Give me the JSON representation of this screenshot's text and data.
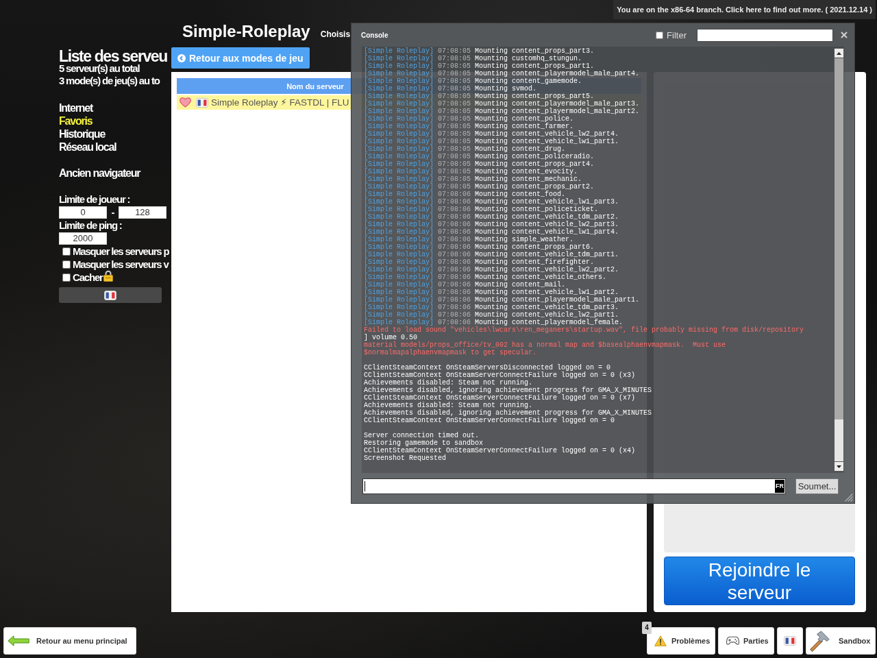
{
  "banner": {
    "text": "You are on the x86-64 branch. Click here to find out more. ( 2021.12.14 )"
  },
  "header": {
    "title": "Simple-Roleplay",
    "subtitle": "Choisis",
    "back_button": "Retour aux modes de jeu"
  },
  "sidebar": {
    "title": "Liste des serveu",
    "stats": [
      "5 serveur(s) au total",
      "3 mode(s) de jeu(s) au to"
    ],
    "tabs": [
      {
        "label": "Internet",
        "selected": false
      },
      {
        "label": "Favoris",
        "selected": true
      },
      {
        "label": "Historique",
        "selected": false
      },
      {
        "label": "Réseau local",
        "selected": false
      }
    ],
    "legacy_link": "Ancien navigateur",
    "player_limit": {
      "label": "Limite de joueur :",
      "min": "0",
      "separator": "-",
      "max": "128"
    },
    "ping_limit": {
      "label": "Limite de ping :",
      "value": "2000"
    },
    "options": [
      {
        "label": "Masquer les serveurs p",
        "checked": false
      },
      {
        "label": "Masquer les serveurs v",
        "checked": false
      },
      {
        "label": "Cacher",
        "checked": false,
        "locked": true
      }
    ]
  },
  "server_table": {
    "columns": [
      "Nom du serveur"
    ],
    "rows": [
      {
        "favorite": true,
        "name": "Simple Roleplay ⚡ FASTDL | FLU",
        "selected": true
      }
    ]
  },
  "server_details": {
    "join_button": "Rejoindre le serveur"
  },
  "console": {
    "title": "Console",
    "filter": {
      "label": "Filter",
      "checked": false
    },
    "lines": [
      {
        "kind": "server",
        "source": "[Simple Roleplay]",
        "time": "07:08:05",
        "text": "Mounting content_props_part3."
      },
      {
        "kind": "server",
        "source": "[Simple Roleplay]",
        "time": "07:08:05",
        "text": "Mounting customhq_stungun."
      },
      {
        "kind": "server",
        "source": "[Simple Roleplay]",
        "time": "07:08:05",
        "text": "Mounting content_props_part1."
      },
      {
        "kind": "server",
        "source": "[Simple Roleplay]",
        "time": "07:08:05",
        "text": "Mounting content_playermodel_male_part4."
      },
      {
        "kind": "server",
        "source": "[Simple Roleplay]",
        "time": "07:08:05",
        "text": "Mounting content_gamemode."
      },
      {
        "kind": "server",
        "source": "[Simple Roleplay]",
        "time": "07:08:05",
        "text": "Mounting svmod."
      },
      {
        "kind": "server",
        "source": "[Simple Roleplay]",
        "time": "07:08:05",
        "text": "Mounting content_props_part5."
      },
      {
        "kind": "server",
        "source": "[Simple Roleplay]",
        "time": "07:08:05",
        "text": "Mounting content_playermodel_male_part3."
      },
      {
        "kind": "server",
        "source": "[Simple Roleplay]",
        "time": "07:08:05",
        "text": "Mounting content_playermodel_male_part2."
      },
      {
        "kind": "server",
        "source": "[Simple Roleplay]",
        "time": "07:08:05",
        "text": "Mounting content_police."
      },
      {
        "kind": "server",
        "source": "[Simple Roleplay]",
        "time": "07:08:05",
        "text": "Mounting content_farmer."
      },
      {
        "kind": "server",
        "source": "[Simple Roleplay]",
        "time": "07:08:05",
        "text": "Mounting content_vehicle_lw2_part4."
      },
      {
        "kind": "server",
        "source": "[Simple Roleplay]",
        "time": "07:08:05",
        "text": "Mounting content_vehicle_lw1_part1."
      },
      {
        "kind": "server",
        "source": "[Simple Roleplay]",
        "time": "07:08:05",
        "text": "Mounting content_drug."
      },
      {
        "kind": "server",
        "source": "[Simple Roleplay]",
        "time": "07:08:05",
        "text": "Mounting content_policeradio."
      },
      {
        "kind": "server",
        "source": "[Simple Roleplay]",
        "time": "07:08:05",
        "text": "Mounting content_props_part4."
      },
      {
        "kind": "server",
        "source": "[Simple Roleplay]",
        "time": "07:08:05",
        "text": "Mounting content_evocity."
      },
      {
        "kind": "server",
        "source": "[Simple Roleplay]",
        "time": "07:08:05",
        "text": "Mounting content_mechanic."
      },
      {
        "kind": "server",
        "source": "[Simple Roleplay]",
        "time": "07:08:05",
        "text": "Mounting content_props_part2."
      },
      {
        "kind": "server",
        "source": "[Simple Roleplay]",
        "time": "07:08:06",
        "text": "Mounting content_food."
      },
      {
        "kind": "server",
        "source": "[Simple Roleplay]",
        "time": "07:08:06",
        "text": "Mounting content_vehicle_lw1_part3."
      },
      {
        "kind": "server",
        "source": "[Simple Roleplay]",
        "time": "07:08:06",
        "text": "Mounting content_policeticket."
      },
      {
        "kind": "server",
        "source": "[Simple Roleplay]",
        "time": "07:08:06",
        "text": "Mounting content_vehicle_tdm_part2."
      },
      {
        "kind": "server",
        "source": "[Simple Roleplay]",
        "time": "07:08:06",
        "text": "Mounting content_vehicle_lw2_part3."
      },
      {
        "kind": "server",
        "source": "[Simple Roleplay]",
        "time": "07:08:06",
        "text": "Mounting content_vehicle_lw1_part4."
      },
      {
        "kind": "server",
        "source": "[Simple Roleplay]",
        "time": "07:08:06",
        "text": "Mounting simple_weather."
      },
      {
        "kind": "server",
        "source": "[Simple Roleplay]",
        "time": "07:08:06",
        "text": "Mounting content_props_part6."
      },
      {
        "kind": "server",
        "source": "[Simple Roleplay]",
        "time": "07:08:06",
        "text": "Mounting content_vehicle_tdm_part1."
      },
      {
        "kind": "server",
        "source": "[Simple Roleplay]",
        "time": "07:08:06",
        "text": "Mounting content_firefighter."
      },
      {
        "kind": "server",
        "source": "[Simple Roleplay]",
        "time": "07:08:06",
        "text": "Mounting content_vehicle_lw2_part2."
      },
      {
        "kind": "server",
        "source": "[Simple Roleplay]",
        "time": "07:08:06",
        "text": "Mounting content_vehicle_others."
      },
      {
        "kind": "server",
        "source": "[Simple Roleplay]",
        "time": "07:08:06",
        "text": "Mounting content_mail."
      },
      {
        "kind": "server",
        "source": "[Simple Roleplay]",
        "time": "07:08:06",
        "text": "Mounting content_vehicle_lw1_part2."
      },
      {
        "kind": "server",
        "source": "[Simple Roleplay]",
        "time": "07:08:06",
        "text": "Mounting content_playermodel_male_part1."
      },
      {
        "kind": "server",
        "source": "[Simple Roleplay]",
        "time": "07:08:06",
        "text": "Mounting content_vehicle_tdm_part3."
      },
      {
        "kind": "server",
        "source": "[Simple Roleplay]",
        "time": "07:08:06",
        "text": "Mounting content_vehicle_lw2_part1."
      },
      {
        "kind": "server",
        "source": "[Simple Roleplay]",
        "time": "07:08:06",
        "text": "Mounting content_playermodel_female."
      },
      {
        "kind": "error",
        "text": "Failed to load sound \"vehicles\\lwcars\\ren_meganers\\startup.wav\", file probably missing from disk/repository"
      },
      {
        "kind": "plain",
        "text": "] volume 0.50"
      },
      {
        "kind": "error",
        "text": "material models/props_office/tv_002 has a normal map and $basealphaenvmapmask.  Must use $normalmapalphaenvmapmask to get specular."
      },
      {
        "kind": "plain",
        "text": "CClientSteamContext OnSteamServersDisconnected logged on = 0",
        "gap_before": true
      },
      {
        "kind": "plain",
        "text": "CClientSteamContext OnSteamServerConnectFailure logged on = 0 (x3)"
      },
      {
        "kind": "plain",
        "text": "Achievements disabled: Steam not running."
      },
      {
        "kind": "plain",
        "text": "Achievements disabled, ignoring achievement progress for GMA_X_MINUTES"
      },
      {
        "kind": "plain",
        "text": "CClientSteamContext OnSteamServerConnectFailure logged on = 0 (x7)"
      },
      {
        "kind": "plain",
        "text": "Achievements disabled: Steam not running."
      },
      {
        "kind": "plain",
        "text": "Achievements disabled, ignoring achievement progress for GMA_X_MINUTES"
      },
      {
        "kind": "plain",
        "text": "CClientSteamContext OnSteamServerConnectFailure logged on = 0"
      },
      {
        "kind": "plain",
        "text": "Server connection timed out.",
        "gap_before": true
      },
      {
        "kind": "plain",
        "text": "Restoring gamemode to sandbox"
      },
      {
        "kind": "plain",
        "text": "CClientSteamContext OnSteamServerConnectFailure logged on = 0 (x4)"
      },
      {
        "kind": "plain",
        "text": "Screenshot Requested"
      }
    ],
    "input_language": "FR",
    "submit_button": "Soumet..."
  },
  "bottom_bar": {
    "back_button": "Retour au menu principal",
    "buttons": [
      {
        "kind": "problems",
        "label": "Problèmes",
        "count": "4"
      },
      {
        "kind": "games",
        "label": "Parties"
      },
      {
        "kind": "language"
      },
      {
        "kind": "gamemode",
        "label": "Sandbox"
      }
    ]
  }
}
